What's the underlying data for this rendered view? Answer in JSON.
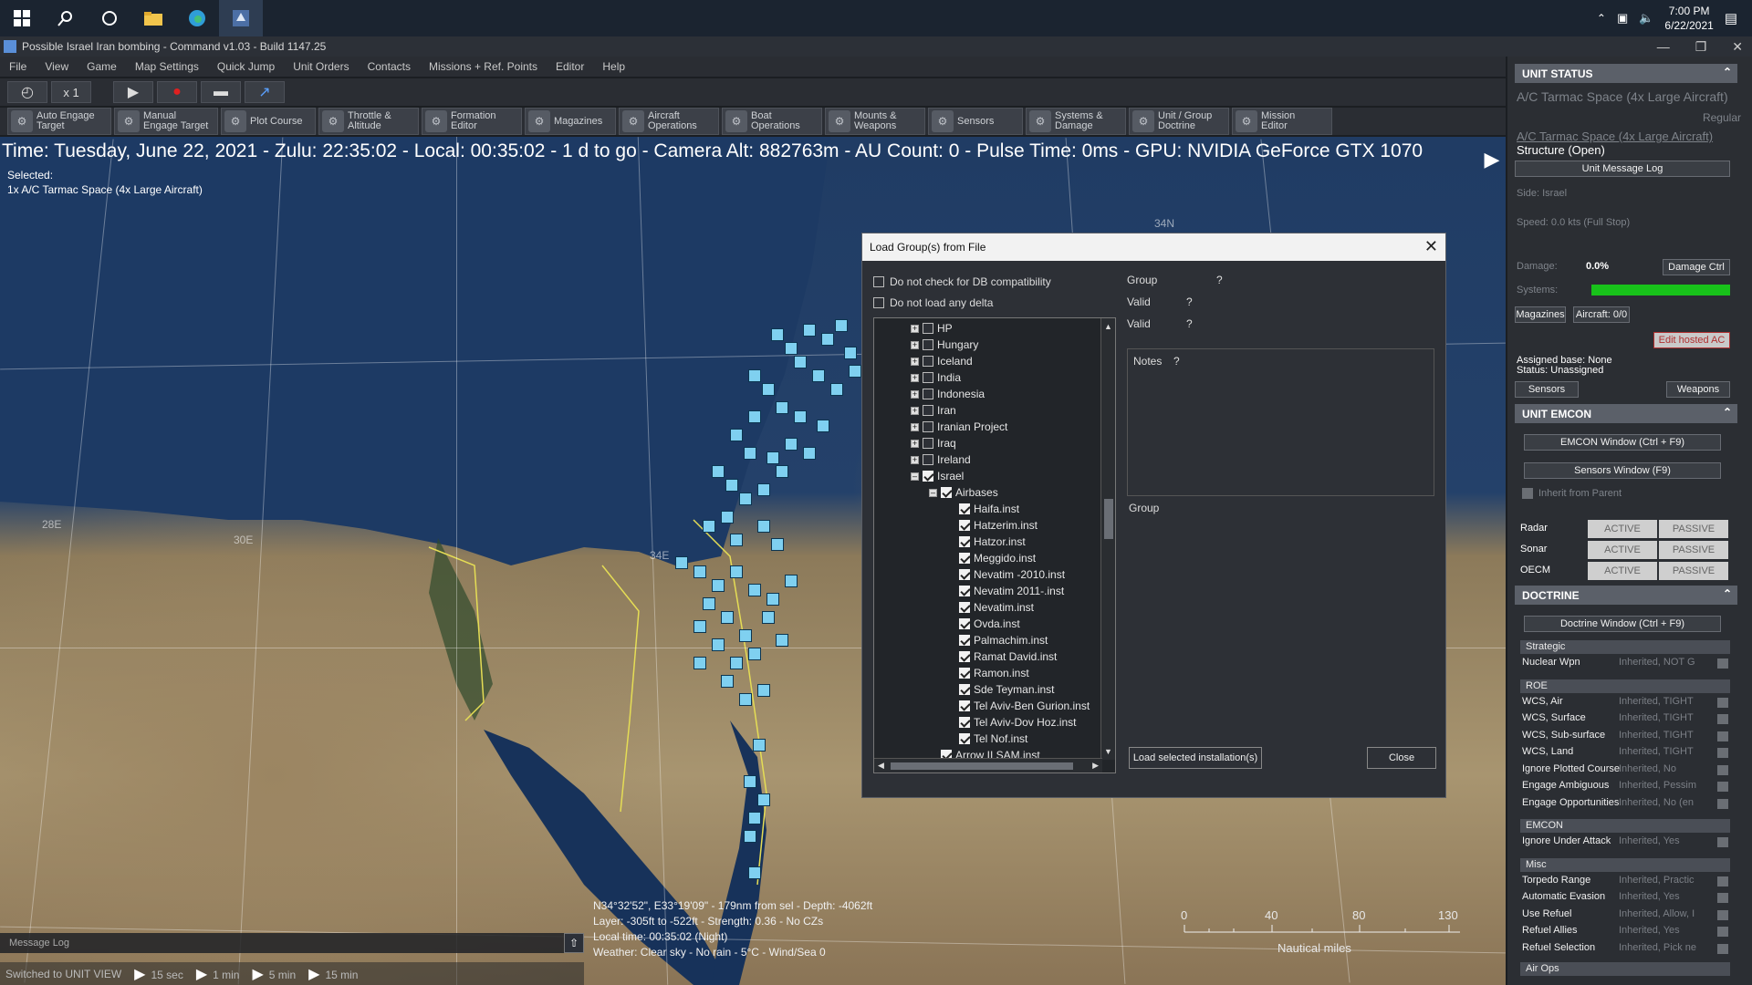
{
  "taskbar": {
    "time": "7:00 PM",
    "date": "6/22/2021"
  },
  "window": {
    "title": "Possible Israel Iran bombing - Command v1.03 - Build 1147.25"
  },
  "menu": [
    "File",
    "View",
    "Game",
    "Map Settings",
    "Quick Jump",
    "Unit Orders",
    "Contacts",
    "Missions + Ref. Points",
    "Editor",
    "Help"
  ],
  "sim": {
    "speed": "x 1"
  },
  "toolbar": [
    {
      "l1": "Auto Engage",
      "l2": "Target"
    },
    {
      "l1": "Manual",
      "l2": "Engage Target"
    },
    {
      "l1": "Plot Course",
      "l2": ""
    },
    {
      "l1": "Throttle &",
      "l2": "Altitude"
    },
    {
      "l1": "Formation",
      "l2": "Editor"
    },
    {
      "l1": "Magazines",
      "l2": ""
    },
    {
      "l1": "Aircraft",
      "l2": "Operations"
    },
    {
      "l1": "Boat",
      "l2": "Operations"
    },
    {
      "l1": "Mounts &",
      "l2": "Weapons"
    },
    {
      "l1": "Sensors",
      "l2": ""
    },
    {
      "l1": "Systems &",
      "l2": "Damage"
    },
    {
      "l1": "Unit / Group",
      "l2": "Doctrine"
    },
    {
      "l1": "Mission",
      "l2": "Editor"
    }
  ],
  "map": {
    "status_line": "Time: Tuesday, June 22, 2021 - Zulu: 22:35:02 - Local: 00:35:02 - 1 d to go -  Camera Alt: 882763m  - AU Count: 0 - Pulse Time: 0ms - GPU: NVIDIA GeForce GTX 1070",
    "selected_label": "Selected:",
    "selected_value": "1x A/C Tarmac Space (4x Large Aircraft)",
    "coords": [
      "28E",
      "30E",
      "34E",
      "34N"
    ],
    "cursor": {
      "l1": "N34°32'52\", E33°19'09\" - 179nm from sel - Depth: -4062ft",
      "l2": "Layer: -305ft to -522ft - Strength: 0.36 - No CZs",
      "l3": "Local time: 00:35:02 (Night)",
      "l4": "Weather: Clear sky - No rain - 5°C - Wind/Sea 0"
    },
    "scale": {
      "ticks": [
        "0",
        "40",
        "80",
        "130"
      ],
      "unit": "Nautical miles"
    },
    "message_log": "Message Log",
    "timebar": {
      "status": "Switched to UNIT VIEW",
      "steps": [
        "15 sec",
        "1 min",
        "5 min",
        "15 min"
      ]
    }
  },
  "dialog": {
    "title": "Load Group(s) from File",
    "opt1": "Do not check for DB compatibility",
    "opt2": "Do not load any delta",
    "tree": [
      {
        "label": "HP",
        "level": 0,
        "exp": "+",
        "checked": false
      },
      {
        "label": "Hungary",
        "level": 0,
        "exp": "+",
        "checked": false
      },
      {
        "label": "Iceland",
        "level": 0,
        "exp": "+",
        "checked": false
      },
      {
        "label": "India",
        "level": 0,
        "exp": "+",
        "checked": false
      },
      {
        "label": "Indonesia",
        "level": 0,
        "exp": "+",
        "checked": false
      },
      {
        "label": "Iran",
        "level": 0,
        "exp": "+",
        "checked": false
      },
      {
        "label": "Iranian Project",
        "level": 0,
        "exp": "+",
        "checked": false
      },
      {
        "label": "Iraq",
        "level": 0,
        "exp": "+",
        "checked": false
      },
      {
        "label": "Ireland",
        "level": 0,
        "exp": "+",
        "checked": false
      },
      {
        "label": "Israel",
        "level": 0,
        "exp": "-",
        "checked": true
      },
      {
        "label": "Airbases",
        "level": 1,
        "exp": "-",
        "checked": true
      },
      {
        "label": "Haifa.inst",
        "level": 2,
        "exp": "",
        "checked": true
      },
      {
        "label": "Hatzerim.inst",
        "level": 2,
        "exp": "",
        "checked": true
      },
      {
        "label": "Hatzor.inst",
        "level": 2,
        "exp": "",
        "checked": true
      },
      {
        "label": "Meggido.inst",
        "level": 2,
        "exp": "",
        "checked": true
      },
      {
        "label": "Nevatim -2010.inst",
        "level": 2,
        "exp": "",
        "checked": true
      },
      {
        "label": "Nevatim 2011-.inst",
        "level": 2,
        "exp": "",
        "checked": true
      },
      {
        "label": "Nevatim.inst",
        "level": 2,
        "exp": "",
        "checked": true
      },
      {
        "label": "Ovda.inst",
        "level": 2,
        "exp": "",
        "checked": true
      },
      {
        "label": "Palmachim.inst",
        "level": 2,
        "exp": "",
        "checked": true
      },
      {
        "label": "Ramat David.inst",
        "level": 2,
        "exp": "",
        "checked": true
      },
      {
        "label": "Ramon.inst",
        "level": 2,
        "exp": "",
        "checked": true
      },
      {
        "label": "Sde Teyman.inst",
        "level": 2,
        "exp": "",
        "checked": true
      },
      {
        "label": "Tel Aviv-Ben Gurion.inst",
        "level": 2,
        "exp": "",
        "checked": true
      },
      {
        "label": "Tel Aviv-Dov Hoz.inst",
        "level": 2,
        "exp": "",
        "checked": true
      },
      {
        "label": "Tel Nof.inst",
        "level": 2,
        "exp": "",
        "checked": true
      },
      {
        "label": "Arrow II SAM.inst",
        "level": 1,
        "exp": "",
        "checked": true
      }
    ],
    "group_label": "Group",
    "valid_label": "Valid",
    "q": "?",
    "notes_label": "Notes",
    "group_label2": "Group",
    "load_btn": "Load selected installation(s)",
    "close_btn": "Close"
  },
  "panel": {
    "unit_status": "UNIT STATUS",
    "unit_name": "A/C Tarmac Space (4x Large Aircraft)",
    "unit_class": "Regular",
    "unit_link": "A/C Tarmac Space (4x Large Aircraft)",
    "structure": "Structure (Open)",
    "msg_log_btn": "Unit Message Log",
    "side": "Side: Israel",
    "speed": "Speed: 0.0 kts (Full Stop)",
    "damage_lbl": "Damage:",
    "damage_val": "0.0%",
    "damage_btn": "Damage Ctrl",
    "systems_lbl": "Systems:",
    "systems_level": 1.0,
    "mag_btn": "Magazines",
    "aircraft_btn": "Aircraft: 0/0",
    "edit_hosted": "Edit hosted AC",
    "assigned": "Assigned base: None",
    "status": "Status: Unassigned",
    "sensors_btn": "Sensors",
    "weapons_btn": "Weapons",
    "emcon_hdr": "UNIT EMCON",
    "emcon_btn": "EMCON Window (Ctrl + F9)",
    "sensors_win_btn": "Sensors Window (F9)",
    "inherit": "Inherit from Parent",
    "emcon_rows": [
      "Radar",
      "Sonar",
      "OECM"
    ],
    "active": "ACTIVE",
    "passive": "PASSIVE",
    "doctrine_hdr": "DOCTRINE",
    "doctrine_btn": "Doctrine Window (Ctrl + F9)",
    "strategic": "Strategic",
    "nuclear": {
      "label": "Nuclear Wpn",
      "val": "Inherited, NOT G"
    },
    "roe": "ROE",
    "roe_rows": [
      {
        "label": "WCS, Air",
        "val": "Inherited, TIGHT"
      },
      {
        "label": "WCS, Surface",
        "val": "Inherited, TIGHT"
      },
      {
        "label": "WCS, Sub-surface",
        "val": "Inherited, TIGHT"
      },
      {
        "label": "WCS, Land",
        "val": "Inherited, TIGHT"
      },
      {
        "label": "Ignore Plotted Course",
        "val": "Inherited, No"
      },
      {
        "label": "Engage Ambiguous",
        "val": "Inherited, Pessim"
      },
      {
        "label": "Engage Opportunities",
        "val": "Inherited, No (en"
      }
    ],
    "emcon_sub": "EMCON",
    "ignore_attack": {
      "label": "Ignore Under Attack",
      "val": "Inherited, Yes"
    },
    "misc": "Misc",
    "misc_rows": [
      {
        "label": "Torpedo Range",
        "val": "Inherited, Practic"
      },
      {
        "label": "Automatic Evasion",
        "val": "Inherited, Yes"
      },
      {
        "label": "Use Refuel",
        "val": "Inherited, Allow, I"
      },
      {
        "label": "Refuel Allies",
        "val": "Inherited, Yes"
      },
      {
        "label": "Refuel Selection",
        "val": "Inherited, Pick ne"
      }
    ],
    "air_ops": "Air Ops"
  }
}
